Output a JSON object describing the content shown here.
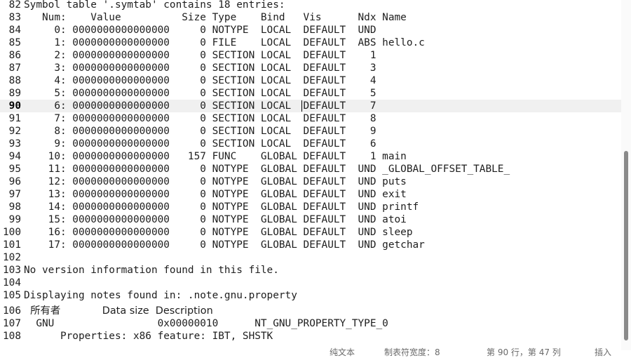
{
  "editor": {
    "current_line": "90",
    "lines": [
      {
        "n": "82",
        "t": "Symbol table '.symtab' contains 18 entries:"
      },
      {
        "n": "83",
        "t": "   Num:    Value          Size Type    Bind   Vis      Ndx Name"
      },
      {
        "n": "84",
        "t": "     0: 0000000000000000     0 NOTYPE  LOCAL  DEFAULT  UND "
      },
      {
        "n": "85",
        "t": "     1: 0000000000000000     0 FILE    LOCAL  DEFAULT  ABS hello.c"
      },
      {
        "n": "86",
        "t": "     2: 0000000000000000     0 SECTION LOCAL  DEFAULT    1 "
      },
      {
        "n": "87",
        "t": "     3: 0000000000000000     0 SECTION LOCAL  DEFAULT    3 "
      },
      {
        "n": "88",
        "t": "     4: 0000000000000000     0 SECTION LOCAL  DEFAULT    4 "
      },
      {
        "n": "89",
        "t": "     5: 0000000000000000     0 SECTION LOCAL  DEFAULT    5 "
      },
      {
        "n": "90",
        "t": "     6: 0000000000000000     0 SECTION LOCAL  DEFAULT    7 "
      },
      {
        "n": "91",
        "t": "     7: 0000000000000000     0 SECTION LOCAL  DEFAULT    8 "
      },
      {
        "n": "92",
        "t": "     8: 0000000000000000     0 SECTION LOCAL  DEFAULT    9 "
      },
      {
        "n": "93",
        "t": "     9: 0000000000000000     0 SECTION LOCAL  DEFAULT    6 "
      },
      {
        "n": "94",
        "t": "    10: 0000000000000000   157 FUNC    GLOBAL DEFAULT    1 main"
      },
      {
        "n": "95",
        "t": "    11: 0000000000000000     0 NOTYPE  GLOBAL DEFAULT  UND _GLOBAL_OFFSET_TABLE_"
      },
      {
        "n": "96",
        "t": "    12: 0000000000000000     0 NOTYPE  GLOBAL DEFAULT  UND puts"
      },
      {
        "n": "97",
        "t": "    13: 0000000000000000     0 NOTYPE  GLOBAL DEFAULT  UND exit"
      },
      {
        "n": "98",
        "t": "    14: 0000000000000000     0 NOTYPE  GLOBAL DEFAULT  UND printf"
      },
      {
        "n": "99",
        "t": "    15: 0000000000000000     0 NOTYPE  GLOBAL DEFAULT  UND atoi"
      },
      {
        "n": "100",
        "t": "    16: 0000000000000000     0 NOTYPE  GLOBAL DEFAULT  UND sleep"
      },
      {
        "n": "101",
        "t": "    17: 0000000000000000     0 NOTYPE  GLOBAL DEFAULT  UND getchar"
      },
      {
        "n": "102",
        "t": ""
      },
      {
        "n": "103",
        "t": "No version information found in this file."
      },
      {
        "n": "104",
        "t": ""
      },
      {
        "n": "105",
        "t": "Displaying notes found in: .note.gnu.property"
      },
      {
        "n": "106",
        "t": "  所有者             Data size  Description"
      },
      {
        "n": "107",
        "t": "  GNU                 0x00000010      NT_GNU_PROPERTY_TYPE_0"
      },
      {
        "n": "108",
        "t": "      Properties: x86 feature: IBT, SHSTK"
      }
    ]
  },
  "status": {
    "fragment_1": "纯文本",
    "fragment_2": "制表符宽度：8",
    "fragment_3": "第 90 行，第 47 列",
    "fragment_4": "插入"
  }
}
